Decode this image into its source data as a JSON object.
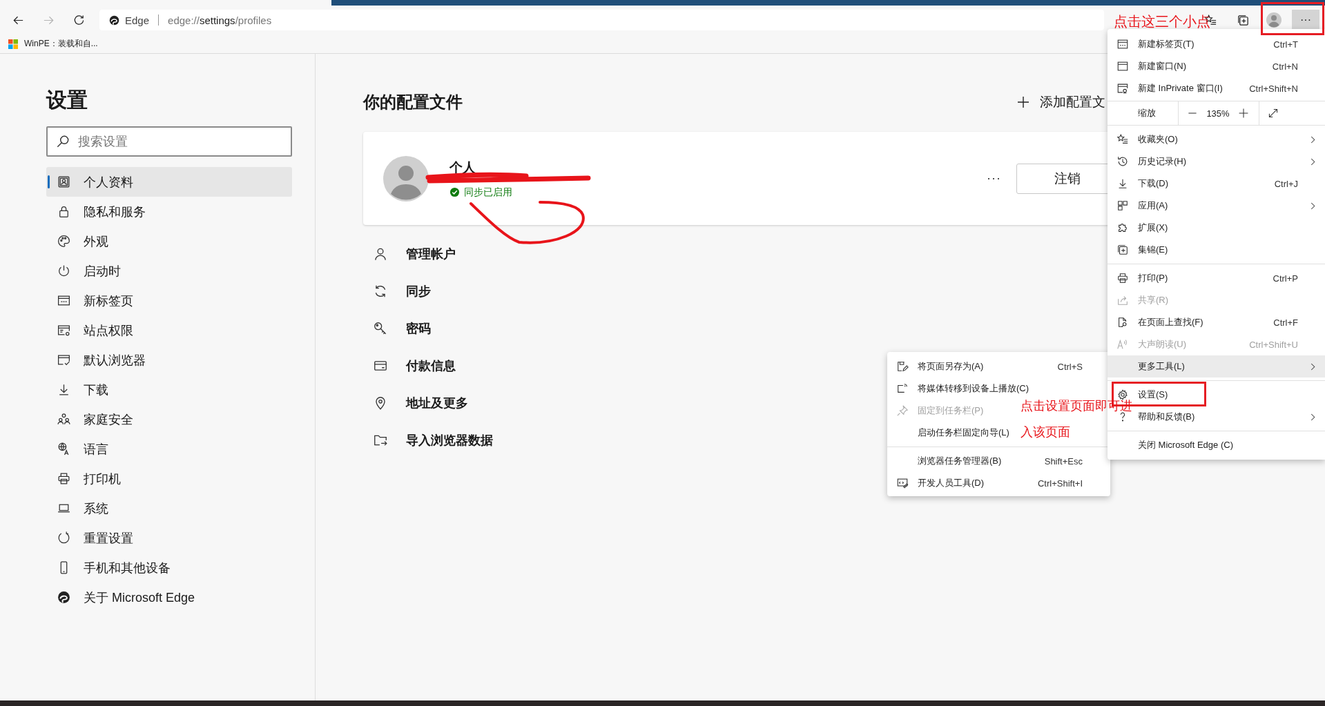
{
  "browser": {
    "address": {
      "site": "Edge",
      "url_prefix": "edge://",
      "url_host": "settings",
      "url_path": "/profiles"
    },
    "bookmarks": [
      {
        "label": "WinPE：装载和自..."
      }
    ],
    "more_button": {
      "label": "···",
      "selected": true
    }
  },
  "sidebar": {
    "title": "设置",
    "search": {
      "placeholder": "搜索设置"
    },
    "items": [
      {
        "label": "个人资料",
        "selected": true
      },
      {
        "label": "隐私和服务",
        "selected": false
      },
      {
        "label": "外观",
        "selected": false
      },
      {
        "label": "启动时",
        "selected": false
      },
      {
        "label": "新标签页",
        "selected": false
      },
      {
        "label": "站点权限",
        "selected": false
      },
      {
        "label": "默认浏览器",
        "selected": false
      },
      {
        "label": "下载",
        "selected": false
      },
      {
        "label": "家庭安全",
        "selected": false
      },
      {
        "label": "语言",
        "selected": false
      },
      {
        "label": "打印机",
        "selected": false
      },
      {
        "label": "系统",
        "selected": false
      },
      {
        "label": "重置设置",
        "selected": false
      },
      {
        "label": "手机和其他设备",
        "selected": false
      },
      {
        "label": "关于 Microsoft Edge",
        "selected": false
      }
    ]
  },
  "profiles": {
    "title": "你的配置文件",
    "add_label": "添加配置文",
    "profile": {
      "name": "个人",
      "sync_status": "同步已启用",
      "more": "···",
      "sign_out": "注销"
    },
    "rows": [
      {
        "label": "管理帐户"
      },
      {
        "label": "同步"
      },
      {
        "label": "密码"
      },
      {
        "label": "付款信息"
      },
      {
        "label": "地址及更多"
      },
      {
        "label": "导入浏览器数据"
      }
    ]
  },
  "menu": {
    "items": [
      {
        "kind": "item",
        "label": "新建标签页(T)",
        "shortcut": "Ctrl+T",
        "submenu": false,
        "disabled": false,
        "selected": false
      },
      {
        "kind": "item",
        "label": "新建窗口(N)",
        "shortcut": "Ctrl+N",
        "submenu": false,
        "disabled": false,
        "selected": false
      },
      {
        "kind": "item",
        "label": "新建 InPrivate 窗口(I)",
        "shortcut": "Ctrl+Shift+N",
        "submenu": false,
        "disabled": false,
        "selected": false
      },
      {
        "kind": "zoom",
        "label": "缩放",
        "value": "135%"
      },
      {
        "kind": "item",
        "label": "收藏夹(O)",
        "submenu": true,
        "disabled": false,
        "selected": false
      },
      {
        "kind": "item",
        "label": "历史记录(H)",
        "submenu": true,
        "disabled": false,
        "selected": false
      },
      {
        "kind": "item",
        "label": "下载(D)",
        "shortcut": "Ctrl+J",
        "submenu": false,
        "disabled": false,
        "selected": false
      },
      {
        "kind": "item",
        "label": "应用(A)",
        "submenu": true,
        "disabled": false,
        "selected": false
      },
      {
        "kind": "item",
        "label": "扩展(X)",
        "submenu": false,
        "disabled": false,
        "selected": false
      },
      {
        "kind": "item",
        "label": "集锦(E)",
        "submenu": false,
        "disabled": false,
        "selected": false
      },
      {
        "kind": "separator"
      },
      {
        "kind": "item",
        "label": "打印(P)",
        "shortcut": "Ctrl+P",
        "submenu": false,
        "disabled": false,
        "selected": false
      },
      {
        "kind": "item",
        "label": "共享(R)",
        "submenu": false,
        "disabled": true,
        "selected": false
      },
      {
        "kind": "item",
        "label": "在页面上查找(F)",
        "shortcut": "Ctrl+F",
        "submenu": false,
        "disabled": false,
        "selected": false
      },
      {
        "kind": "item",
        "label": "大声朗读(U)",
        "shortcut": "Ctrl+Shift+U",
        "submenu": false,
        "disabled": true,
        "selected": false
      },
      {
        "kind": "item",
        "label": "更多工具(L)",
        "submenu": true,
        "disabled": false,
        "selected": true
      },
      {
        "kind": "separator"
      },
      {
        "kind": "item",
        "label": "设置(S)",
        "submenu": false,
        "disabled": false,
        "selected": false
      },
      {
        "kind": "item",
        "label": "帮助和反馈(B)",
        "submenu": true,
        "disabled": false,
        "selected": false
      },
      {
        "kind": "separator"
      },
      {
        "kind": "item",
        "label": "关闭 Microsoft Edge (C)",
        "submenu": false,
        "disabled": false,
        "selected": false
      }
    ]
  },
  "submenu": {
    "items": [
      {
        "kind": "item",
        "label": "将页面另存为(A)",
        "shortcut": "Ctrl+S",
        "disabled": false
      },
      {
        "kind": "item",
        "label": "将媒体转移到设备上播放(C)",
        "disabled": false
      },
      {
        "kind": "item",
        "label": "固定到任务栏(P)",
        "disabled": true
      },
      {
        "kind": "item",
        "label": "启动任务栏固定向导(L)",
        "disabled": false
      },
      {
        "kind": "separator"
      },
      {
        "kind": "item",
        "label": "浏览器任务管理器(B)",
        "shortcut": "Shift+Esc",
        "disabled": false
      },
      {
        "kind": "item",
        "label": "开发人员工具(D)",
        "shortcut": "Ctrl+Shift+I",
        "disabled": false
      }
    ]
  },
  "annotations": [
    {
      "text": "点击这三个小点"
    },
    {
      "text": "点击设置页面即可进"
    },
    {
      "text": "入该页面"
    }
  ]
}
